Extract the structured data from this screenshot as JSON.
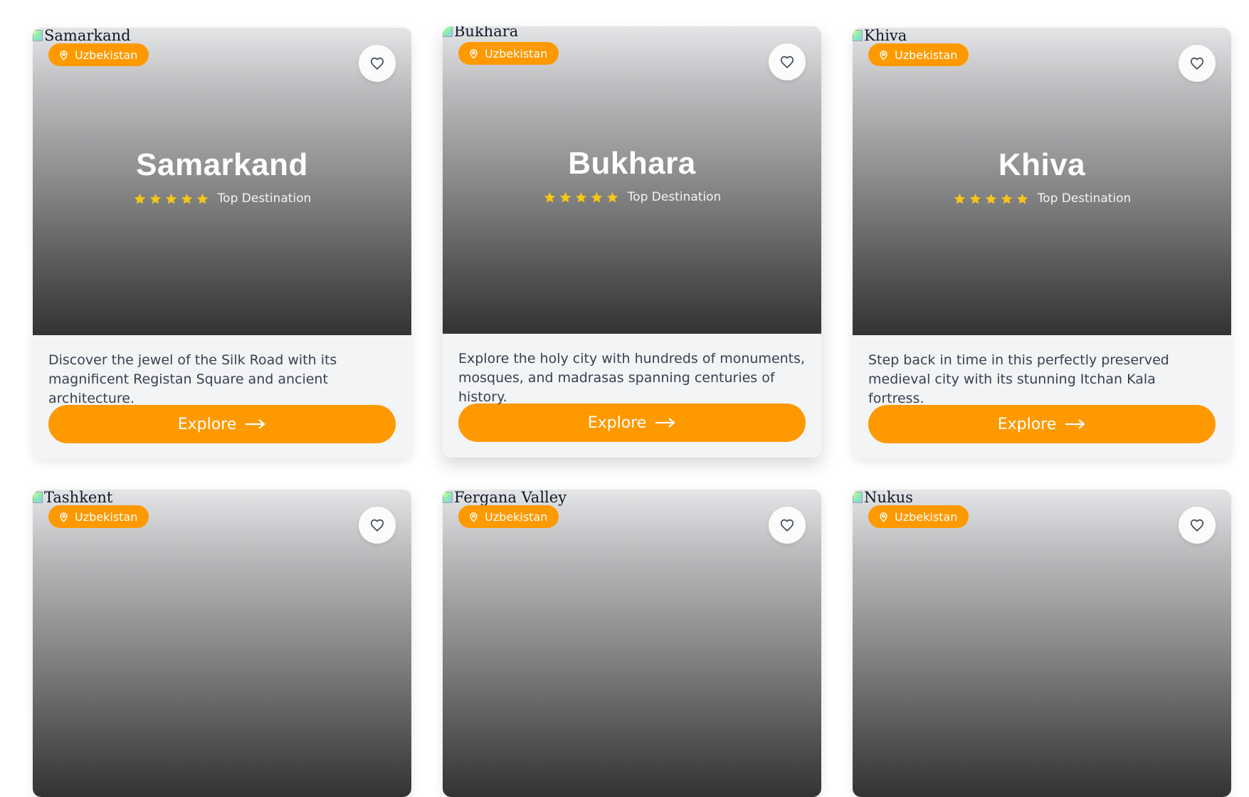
{
  "colors": {
    "accent": "#ff9900",
    "star": "#f7c518"
  },
  "destinations": [
    {
      "name": "Samarkand",
      "alt": "Samarkand",
      "country": "Uzbekistan",
      "rating_label": "Top Destination",
      "stars": 5,
      "description": "Discover the jewel of the Silk Road with its magnificent Registan Square and ancient architecture.",
      "cta": "Explore"
    },
    {
      "name": "Bukhara",
      "alt": "Bukhara",
      "country": "Uzbekistan",
      "rating_label": "Top Destination",
      "stars": 5,
      "description": "Explore the holy city with hundreds of monuments, mosques, and madrasas spanning centuries of history.",
      "cta": "Explore"
    },
    {
      "name": "Khiva",
      "alt": "Khiva",
      "country": "Uzbekistan",
      "rating_label": "Top Destination",
      "stars": 5,
      "description": "Step back in time in this perfectly preserved medieval city with its stunning Itchan Kala fortress.",
      "cta": "Explore"
    },
    {
      "alt": "Tashkent",
      "country": "Uzbekistan"
    },
    {
      "alt": "Fergana Valley",
      "country": "Uzbekistan"
    },
    {
      "alt": "Nukus",
      "country": "Uzbekistan"
    }
  ],
  "icons": {
    "location": "map-pin-icon",
    "favorite": "heart-icon",
    "star": "star-icon",
    "arrow": "arrow-right-icon"
  }
}
